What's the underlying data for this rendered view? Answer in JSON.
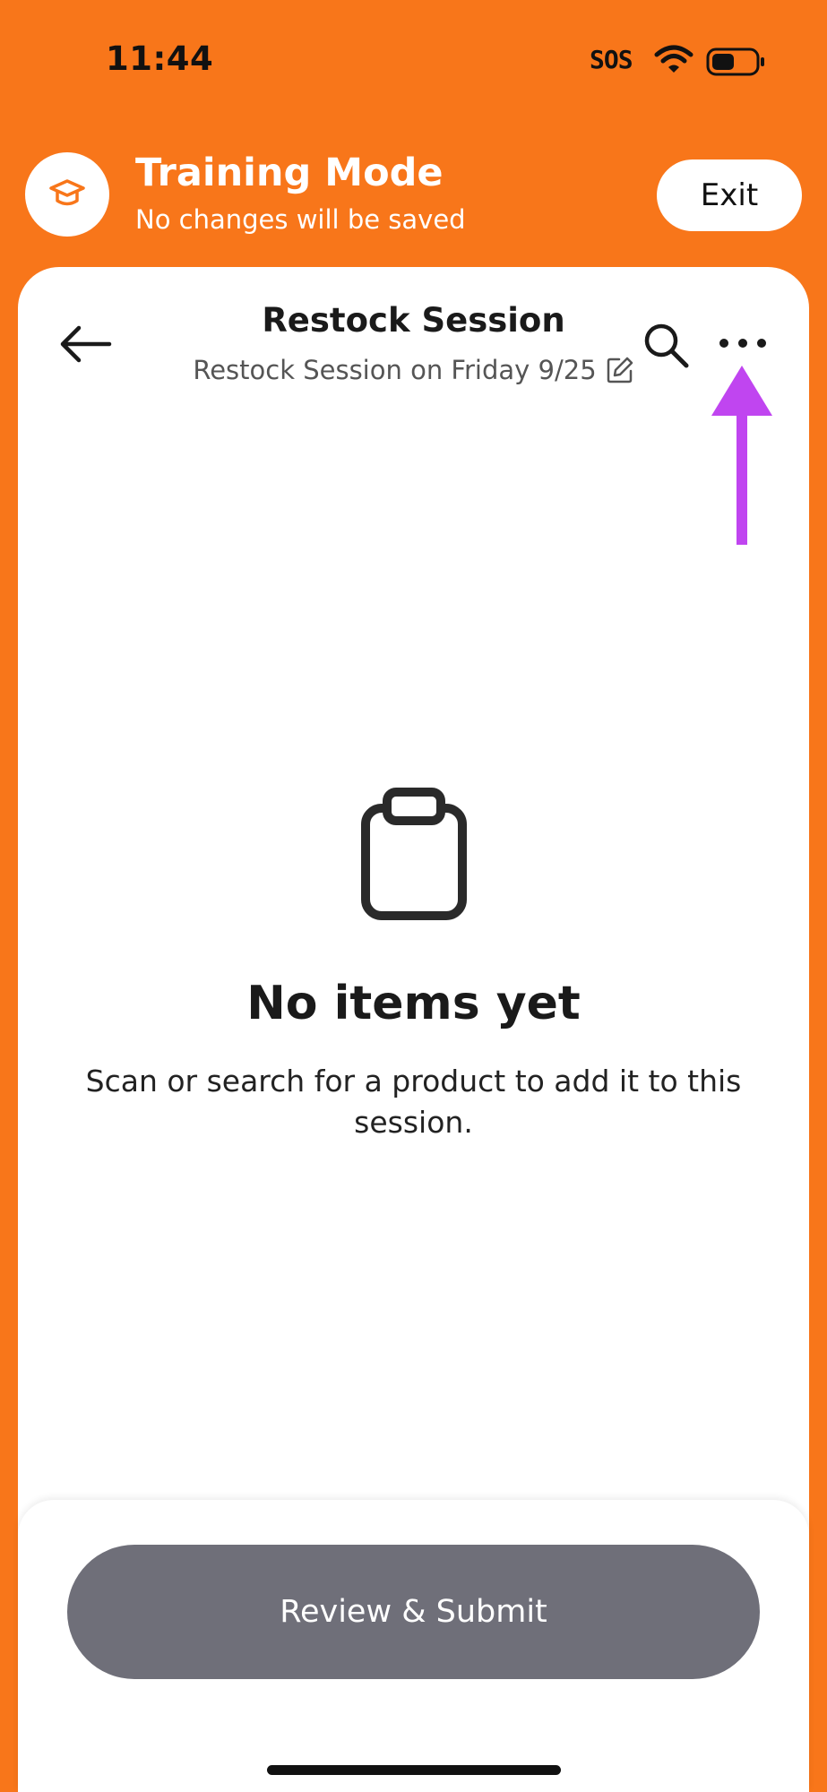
{
  "status_bar": {
    "time": "11:44",
    "carrier": "SOS",
    "wifi_icon": "wifi-icon",
    "battery_icon": "battery-icon"
  },
  "training_banner": {
    "icon": "graduation-cap-icon",
    "title": "Training Mode",
    "subtitle": "No changes will be saved",
    "exit_label": "Exit"
  },
  "header": {
    "back_icon": "arrow-left-icon",
    "title": "Restock Session",
    "subtitle": "Restock Session on Friday 9/25",
    "edit_icon": "pencil-edit-icon",
    "search_icon": "search-icon",
    "more_icon": "more-horizontal-icon"
  },
  "annotation": {
    "icon": "arrow-up-icon",
    "color": "#C045F0"
  },
  "empty_state": {
    "icon": "clipboard-icon",
    "title": "No items yet",
    "description": "Scan or search for a product to add it to this session."
  },
  "footer": {
    "submit_label": "Review & Submit"
  },
  "colors": {
    "brand_orange": "#F8761A",
    "submit_disabled": "#6F6F79",
    "text_primary": "#1A1A1A"
  }
}
